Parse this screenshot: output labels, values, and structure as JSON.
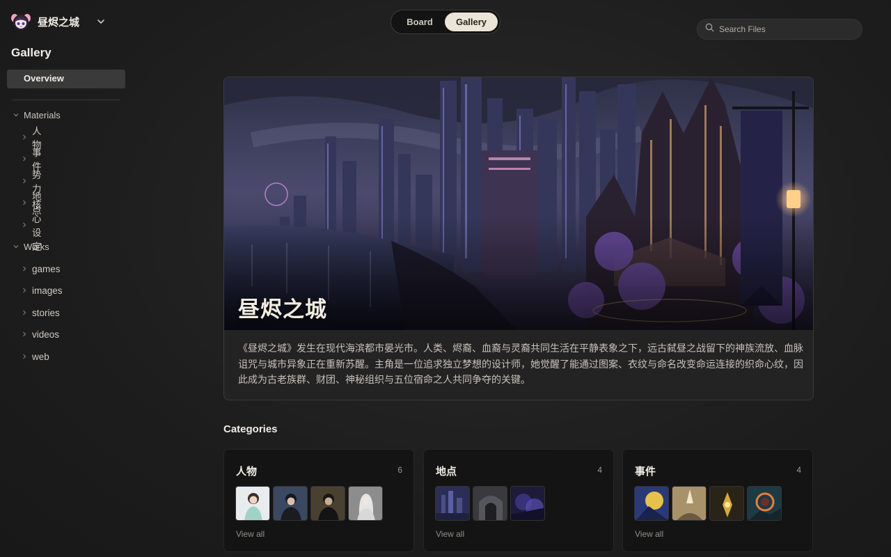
{
  "workspace": {
    "name": "昼烬之城",
    "logo_icon": "anime-mascot-logo"
  },
  "sidebar": {
    "title": "Gallery",
    "overview_label": "Overview",
    "tree": [
      {
        "label": "Materials",
        "children": [
          "人物",
          "事件",
          "势力",
          "地点",
          "核心设定"
        ]
      },
      {
        "label": "Works",
        "children": [
          "games",
          "images",
          "stories",
          "videos",
          "web"
        ]
      }
    ]
  },
  "view_toggle": {
    "options": [
      "Board",
      "Gallery"
    ],
    "selected": "Gallery"
  },
  "search": {
    "placeholder": "Search Files",
    "value": ""
  },
  "hero": {
    "title": "昼烬之城",
    "description": "《昼烬之城》发生在现代海滨都市晏光市。人类、烬裔、血裔与灵裔共同生活在平静表象之下，远古弑昼之战留下的神族流放、血脉诅咒与城市异象正在重新苏醒。主角是一位追求独立梦想的设计师，她觉醒了能通过图案、衣纹与命名改变命运连接的织命心纹，因此成为古老族群、财团、神秘组织与五位宿命之人共同争夺的关键。"
  },
  "categories": {
    "heading": "Categories",
    "items": [
      {
        "name": "人物",
        "count": "6",
        "view_all": "View all"
      },
      {
        "name": "地点",
        "count": "4",
        "view_all": "View all"
      },
      {
        "name": "事件",
        "count": "4",
        "view_all": "View all"
      }
    ]
  },
  "colors": {
    "accent_pill": "#ece4d6",
    "background": "#1d1d1d",
    "card": "#141414"
  }
}
